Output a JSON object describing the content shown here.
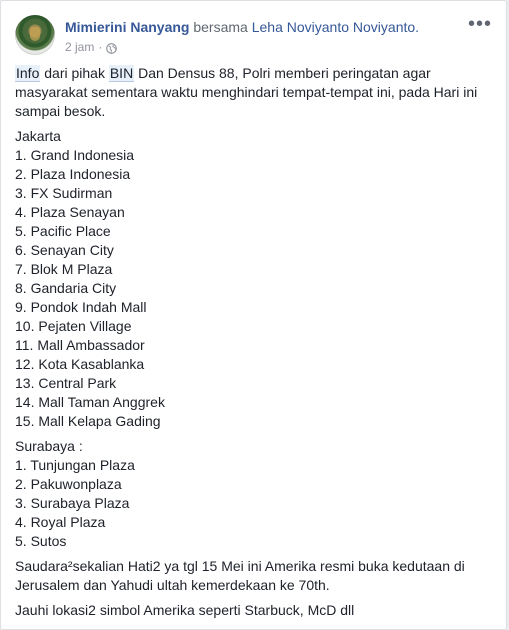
{
  "post": {
    "author": "Mimierini Nanyang",
    "with_text": "bersama",
    "tagged": "Leha Noviyanto Noviyanto.",
    "time": "2 jam",
    "dot": "·",
    "intro": {
      "hl1": "Info",
      "t1": " dari pihak ",
      "hl2": "BIN",
      "t2": " Dan Densus 88, Polri memberi peringatan agar masyarakat sementara waktu menghindari tempat-tempat ini, pada Hari ini sampai besok."
    },
    "jakarta_title": "Jakarta",
    "jakarta": [
      "1. Grand Indonesia",
      "2. Plaza Indonesia",
      "3. FX Sudirman",
      "4. Plaza Senayan",
      "5. Pacific Place",
      "6. Senayan City",
      "7. Blok M Plaza",
      "8. Gandaria City",
      "9. Pondok Indah Mall",
      "10. Pejaten Village",
      "11. Mall Ambassador",
      "12. Kota Kasablanka",
      "13. Central Park",
      "14. Mall Taman Anggrek",
      "15. Mall Kelapa Gading"
    ],
    "surabaya_title": "Surabaya :",
    "surabaya": [
      "1. Tunjungan Plaza",
      "2. Pakuwonplaza",
      "3. Surabaya Plaza",
      "4. Royal Plaza",
      "5. Sutos"
    ],
    "para2": "Saudara²sekalian Hati2 ya tgl 15 Mei ini Amerika resmi buka kedutaan di Jerusalem dan Yahudi ultah kemerdekaan ke 70th.",
    "para3": "Jauhi lokasi2 simbol Amerika seperti Starbuck, McD dll"
  },
  "icons": {
    "privacy": "globe-icon",
    "menu": "more-options-icon"
  },
  "colors": {
    "link": "#365899",
    "text": "#1d2129",
    "meta": "#90949c",
    "highlight_bg": "#e8f0fa"
  }
}
